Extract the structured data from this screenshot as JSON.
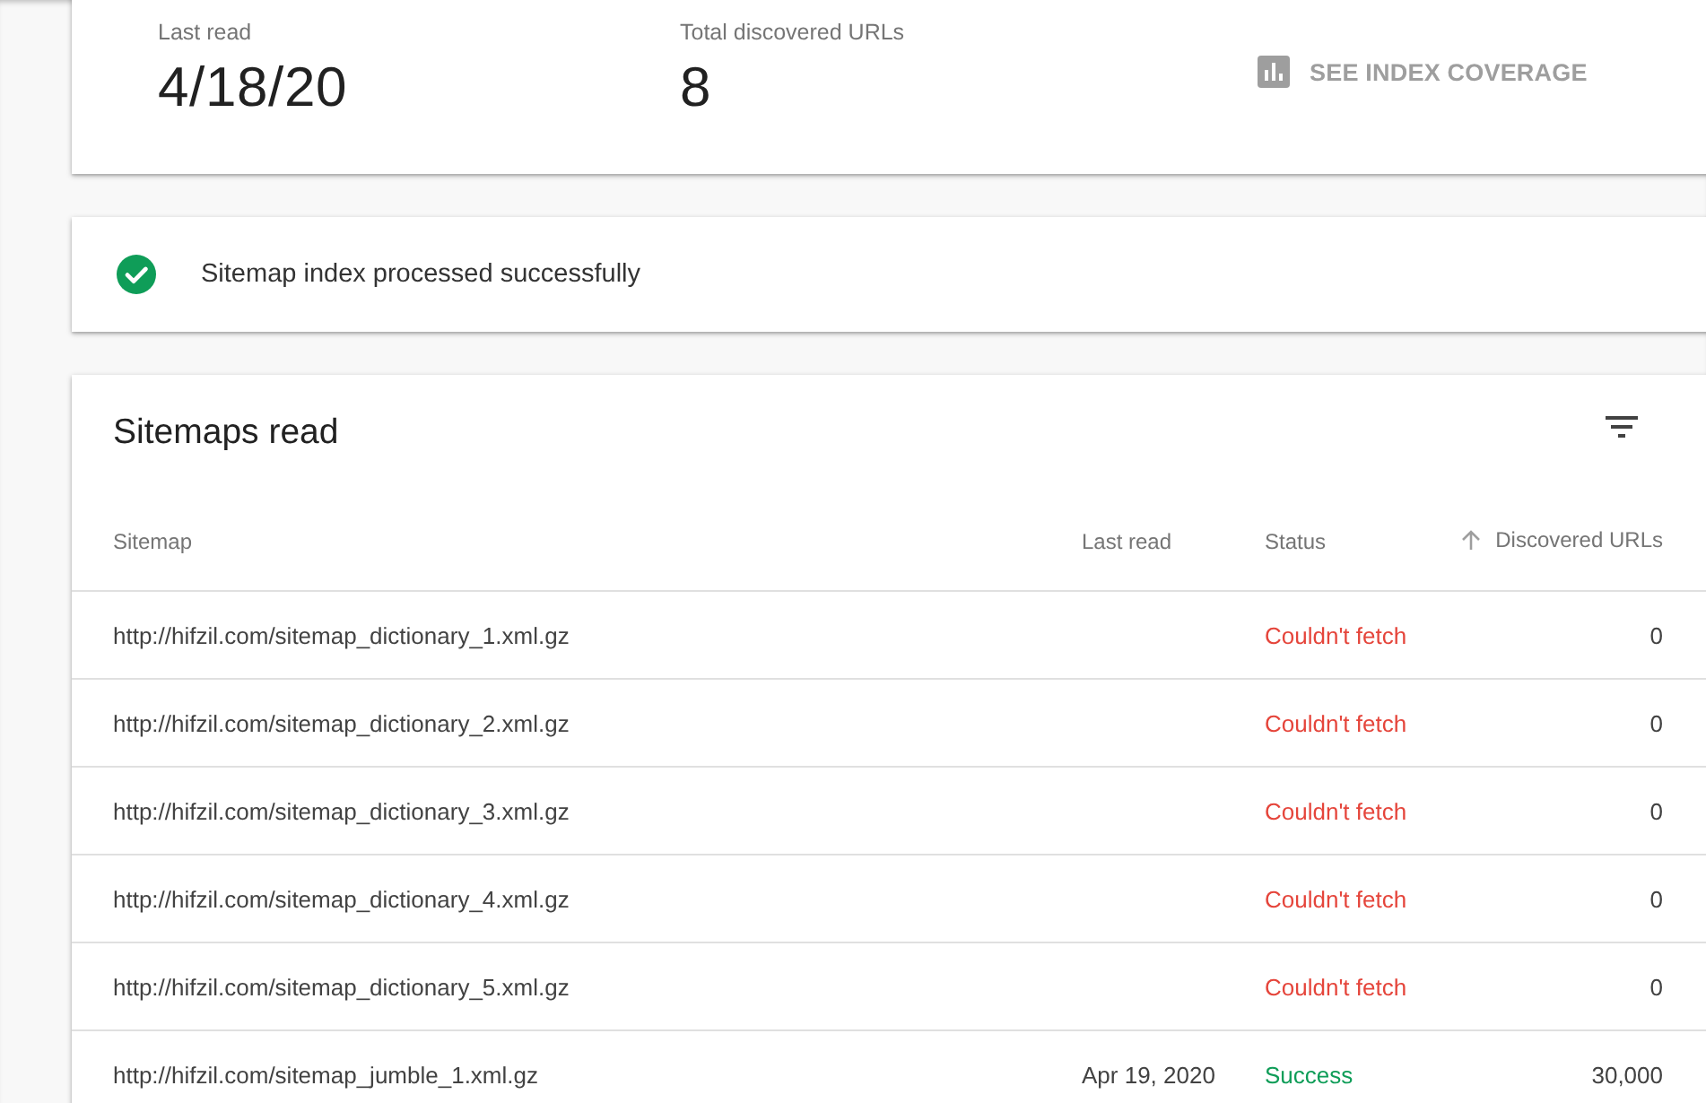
{
  "summary": {
    "stats": [
      {
        "label": "Last read",
        "value": "4/18/20"
      },
      {
        "label": "Total discovered URLs",
        "value": "8"
      }
    ],
    "action": {
      "label": "SEE INDEX COVERAGE"
    }
  },
  "status_message": {
    "kind": "success",
    "text": "Sitemap index processed successfully"
  },
  "table": {
    "title": "Sitemaps read",
    "columns": [
      {
        "label": "Sitemap",
        "sorted": false
      },
      {
        "label": "Last read",
        "sorted": false
      },
      {
        "label": "Status",
        "sorted": false
      },
      {
        "label": "Discovered URLs",
        "sorted": true
      }
    ],
    "rows": [
      {
        "sitemap": "http://hifzil.com/sitemap_dictionary_1.xml.gz",
        "status": {
          "kind": "error",
          "text": "Couldn't fetch"
        },
        "discovered_urls": "0"
      },
      {
        "sitemap": "http://hifzil.com/sitemap_dictionary_2.xml.gz",
        "status": {
          "kind": "error",
          "text": "Couldn't fetch"
        },
        "discovered_urls": "0"
      },
      {
        "sitemap": "http://hifzil.com/sitemap_dictionary_3.xml.gz",
        "status": {
          "kind": "error",
          "text": "Couldn't fetch"
        },
        "discovered_urls": "0"
      },
      {
        "sitemap": "http://hifzil.com/sitemap_dictionary_4.xml.gz",
        "status": {
          "kind": "error",
          "text": "Couldn't fetch"
        },
        "discovered_urls": "0"
      },
      {
        "sitemap": "http://hifzil.com/sitemap_dictionary_5.xml.gz",
        "status": {
          "kind": "error",
          "text": "Couldn't fetch"
        },
        "discovered_urls": "0"
      },
      {
        "sitemap": "http://hifzil.com/sitemap_jumble_1.xml.gz",
        "last_read": "Apr 19, 2020",
        "status": {
          "kind": "success",
          "text": "Success"
        },
        "discovered_urls": "30,000"
      }
    ]
  }
}
